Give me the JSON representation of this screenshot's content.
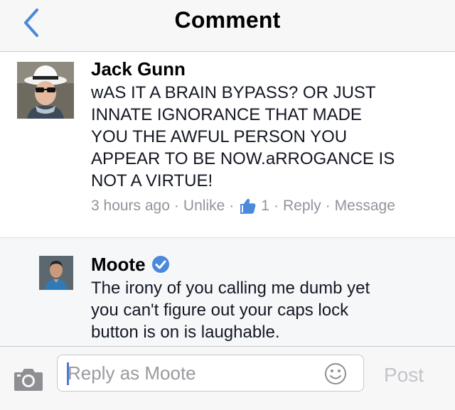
{
  "header": {
    "title": "Comment",
    "back_icon": "chevron-left-icon",
    "accent_color": "#4a89dc"
  },
  "comments": [
    {
      "author": "Jack Gunn",
      "text": "wAS IT A BRAIN BYPASS? OR JUST\nINNATE IGNORANCE THAT MADE\nYOU THE AWFUL PERSON YOU\nAPPEAR TO BE NOW.aRROGANCE IS\nNOT A VIRTUE!",
      "time": "3 hours ago",
      "unlike_label": "Unlike",
      "like_count": "1",
      "reply_label": "Reply",
      "message_label": "Message"
    },
    {
      "author": "Moote",
      "verified": true,
      "text": "The irony of you calling me dumb yet\nyou can't figure out your caps lock\nbutton is on is laughable."
    }
  ],
  "reply_bar": {
    "placeholder": "Reply as Moote",
    "value": "",
    "post_label": "Post",
    "camera_icon": "camera-icon",
    "emoji_icon": "smiley-icon"
  }
}
